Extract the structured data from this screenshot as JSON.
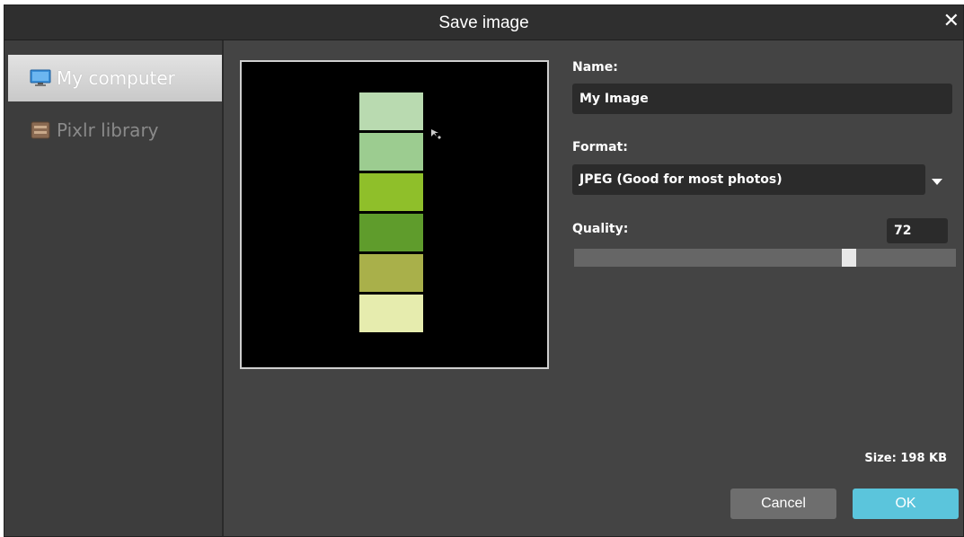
{
  "dialog": {
    "title": "Save image",
    "close_icon": "close-icon"
  },
  "sidebar": {
    "items": [
      {
        "label": "My computer",
        "icon": "computer-icon",
        "active": true
      },
      {
        "label": "Pixlr library",
        "icon": "library-icon",
        "active": false
      }
    ]
  },
  "preview": {
    "swatch_colors": [
      "#b9dab0",
      "#9ccc90",
      "#8fbf2a",
      "#5f9c2c",
      "#a9b04a",
      "#e6ecae"
    ]
  },
  "form": {
    "name_label": "Name:",
    "name_value": "My Image",
    "format_label": "Format:",
    "format_value": "JPEG (Good for most photos)",
    "quality_label": "Quality:",
    "quality_value": "72",
    "quality_level": 0.72
  },
  "footer": {
    "size_text": "Size: 198 KB",
    "cancel_label": "Cancel",
    "ok_label": "OK"
  },
  "colors": {
    "ok_button": "#5bc5dc",
    "dialog_bg": "#444444"
  }
}
